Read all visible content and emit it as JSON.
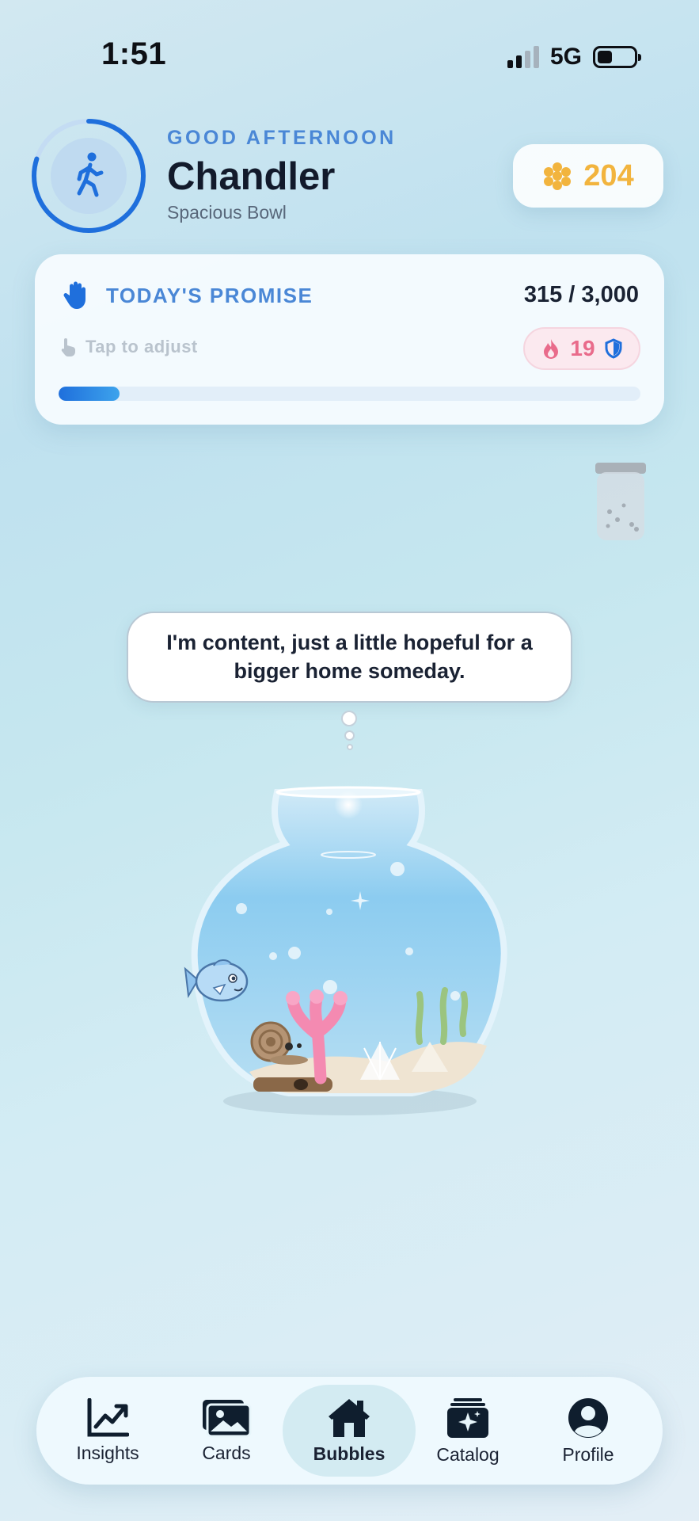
{
  "status_bar": {
    "time": "1:51",
    "network": "5G"
  },
  "header": {
    "greeting": "GOOD AFTERNOON",
    "name": "Chandler",
    "subtitle": "Spacious Bowl",
    "coins": "204",
    "ring_progress": 0.8
  },
  "promise": {
    "title": "TODAY'S PROMISE",
    "count": "315 / 3,000",
    "tap_hint": "Tap to adjust",
    "streak": "19",
    "progress": 0.105
  },
  "speech": "I'm content, just a little hopeful for a bigger home someday.",
  "tabs": [
    {
      "label": "Insights",
      "icon": "chart-icon"
    },
    {
      "label": "Cards",
      "icon": "photos-icon"
    },
    {
      "label": "Bubbles",
      "icon": "home-icon",
      "active": true
    },
    {
      "label": "Catalog",
      "icon": "catalog-icon"
    },
    {
      "label": "Profile",
      "icon": "profile-icon"
    }
  ],
  "colors": {
    "accent": "#1f6fdc",
    "coin": "#f2b43e",
    "streak": "#e96b8b"
  }
}
